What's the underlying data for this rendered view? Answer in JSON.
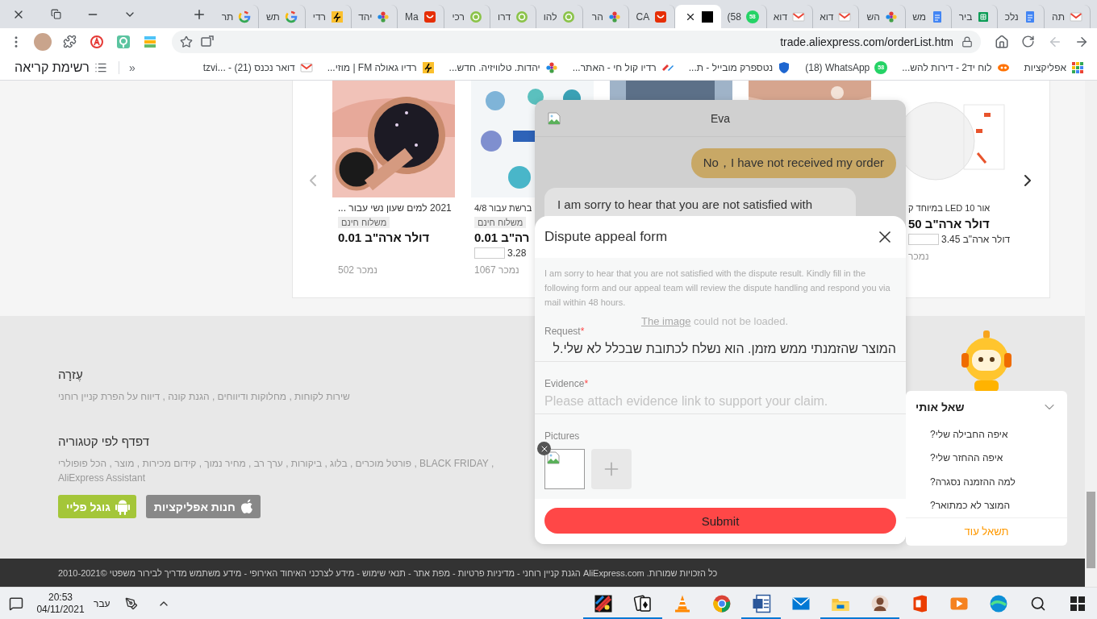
{
  "tab_strip": {
    "tabs": [
      {
        "title": "תה",
        "kind": "gmail",
        "selected": false
      },
      {
        "title": "נלכ",
        "kind": "docs",
        "selected": false
      },
      {
        "title": "ביר",
        "kind": "sheets",
        "selected": false
      },
      {
        "title": "מש",
        "kind": "docs",
        "selected": false
      },
      {
        "title": "הש",
        "kind": "flower",
        "selected": false
      },
      {
        "title": "דוא",
        "kind": "gmail",
        "selected": false
      },
      {
        "title": "דוא",
        "kind": "gmail",
        "selected": false
      },
      {
        "title": "(58",
        "kind": "whatsapp",
        "badge": "58",
        "selected": false
      },
      {
        "kind": "blank",
        "selected": true
      },
      {
        "title": "CA",
        "kind": "ali",
        "selected": false
      },
      {
        "title": "הר",
        "kind": "flower",
        "selected": false
      },
      {
        "title": "להו",
        "kind": "swirl",
        "selected": false
      },
      {
        "title": "דרו",
        "kind": "swirl",
        "selected": false
      },
      {
        "title": "רכי",
        "kind": "swirl",
        "selected": false
      },
      {
        "title": "Ma",
        "kind": "ali",
        "selected": false
      },
      {
        "title": "יהד",
        "kind": "flower",
        "selected": false
      },
      {
        "title": "רדי",
        "kind": "radio",
        "selected": false
      },
      {
        "title": "תש",
        "kind": "google",
        "selected": false
      },
      {
        "title": "תר",
        "kind": "google",
        "selected": false
      }
    ]
  },
  "toolbar": {
    "url": "trade.aliexpress.com/orderList.htm",
    "back_disabled": false,
    "forward_disabled": true
  },
  "bookmarks": {
    "reading_list": "רשימת קריאה",
    "overflow": "»",
    "items": [
      {
        "title": "אפליקציות",
        "kind": "apps"
      },
      {
        "title": "לוח יד2 - דירות להש...",
        "kind": "yad2"
      },
      {
        "title": "(18) WhatsApp",
        "kind": "whatsapp",
        "badge": "58"
      },
      {
        "title": "נטספרק מובייל - ת...",
        "kind": "shield"
      },
      {
        "title": "רדיו קול חי - האתר...",
        "kind": "kolchai"
      },
      {
        "title": "יהדות. טלוויזיה. חדש...",
        "kind": "flower"
      },
      {
        "title": "רדיו גאולה FM | מוזי...",
        "kind": "radio"
      },
      {
        "title": "דואר נכנס tzvi... - (21)",
        "kind": "gmail"
      }
    ]
  },
  "carousel": {
    "products": [
      {
        "kind": "picture",
        "title": "אור LED 10 במיוחד ק",
        "price": "דולר ארה\"ב 50",
        "unit_price": "דולר ארה\"ב 3.45",
        "sold": "נמכר"
      },
      {
        "kind": "picture"
      },
      {
        "kind": "picture"
      },
      {
        "kind": "picture",
        "title": "ברשת עבור 4/8",
        "tag": "משלוח חינם",
        "price": "רה\"ב 0.01",
        "unit_price": "3.28",
        "sold": "נמכר 1067"
      },
      {
        "kind": "picture",
        "title": "2021 למים שעון נשי עבור ...",
        "tag": "משלוח חינם",
        "price": "דולר ארה\"ב 0.01",
        "sold": "נמכר 502"
      }
    ]
  },
  "footer": {
    "sections": [
      {
        "heading": "עֶזרָה",
        "links": "שירות לקוחות , מחלוקות ודיווחים , הגנת קונה , דיווח על הפרת קניין רוחני"
      },
      {
        "heading": "דפדף לפי קטגוריה",
        "links": "פורטל מוכרים , בלוג , ביקורות , ערך רב , מחיר נמוך , קידום מכירות , מוצר , הכל פופולרי , BLACK FRIDAY , AliExpress Assistant"
      }
    ],
    "app_buttons": [
      {
        "label": "חנות אפליקציות",
        "kind": "apple"
      },
      {
        "label": "גוגל פליי",
        "kind": "android"
      }
    ],
    "copyright": "כל הזכויות שמורות. AliExpress.com הגנת קניין רוחני - מדיניות פרטיות - מפת אתר - תנאי שימוש - מידע לצרכני האיחוד האירופי - מידע משתמש מדריך לבירור משפטי ©2010-2021"
  },
  "chat": {
    "title": "Eva",
    "messages": [
      {
        "kind": "user",
        "text": "No，I have not received my order"
      },
      {
        "kind": "bot",
        "text": "I am sorry to hear that you are not satisfied with"
      }
    ]
  },
  "appeal_form": {
    "title": "Dispute appeal form",
    "intro": "I am sorry to hear that you are not satisfied with the dispute result. Kindly fill in the following form and our appeal team will review the dispute handling and respond you via mail within 48 hours.",
    "broken_image": {
      "link": "The image",
      "text": "could not be loaded."
    },
    "fields": [
      {
        "kind": "text",
        "label": "Request",
        "required_mark": "*",
        "value": "המוצר שהזמנתי ממש מזמן. הוא נשלח לכתובת שבכלל לא שלי.ל"
      },
      {
        "kind": "text",
        "label": "Evidence",
        "required_mark": "*",
        "placeholder": "Please attach evidence link to support your claim."
      },
      {
        "kind": "pictures",
        "label": "Pictures"
      }
    ],
    "submit": "Submit"
  },
  "ask_me": {
    "title": "שאל אותי",
    "expanded": true,
    "questions": [
      "איפה החבילה שלי?",
      "איפה ההחזר שלי?",
      "למה ההזמנה נסגרה?",
      "המוצר לא כמתואר?"
    ],
    "more": "תשאל עוד"
  },
  "taskbar": {
    "time": "20:53",
    "date": "04/11/2021",
    "language": "עבר",
    "apps": [
      {
        "kind": "paint",
        "running": true
      },
      {
        "kind": "cards",
        "running": true
      },
      {
        "kind": "cone",
        "running": false
      },
      {
        "kind": "browser",
        "running": false
      },
      {
        "kind": "word",
        "running": true
      },
      {
        "kind": "mail",
        "running": false
      },
      {
        "kind": "folder",
        "running": true
      },
      {
        "kind": "profile",
        "running": true
      },
      {
        "kind": "office",
        "running": false
      },
      {
        "kind": "media",
        "running": false
      },
      {
        "kind": "wave",
        "running": false
      },
      {
        "kind": "search",
        "running": false
      },
      {
        "kind": "start",
        "running": false
      }
    ]
  }
}
